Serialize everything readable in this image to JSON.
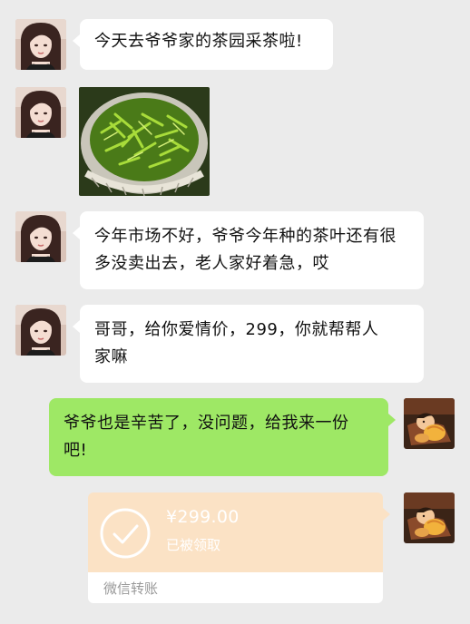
{
  "messages": [
    {
      "text": "今天去爷爷家的茶园采茶啦!"
    },
    {
      "text": "今年市场不好，爷爷今年种的茶叶还有很多没卖出去，老人家好着急，哎"
    },
    {
      "text": "哥哥，给你爱情价，299，你就帮帮人家嘛"
    },
    {
      "text": "爷爷也是辛苦了，没问题，给我来一份吧!"
    }
  ],
  "transfer": {
    "amount": "¥299.00",
    "status": "已被领取",
    "label": "微信转账"
  },
  "colors": {
    "background": "#ebebeb",
    "incoming_bubble": "#ffffff",
    "outgoing_bubble": "#9ee865",
    "transfer_card": "#fbe2c5"
  },
  "icons": {
    "transfer_status": "check-circle-icon"
  }
}
